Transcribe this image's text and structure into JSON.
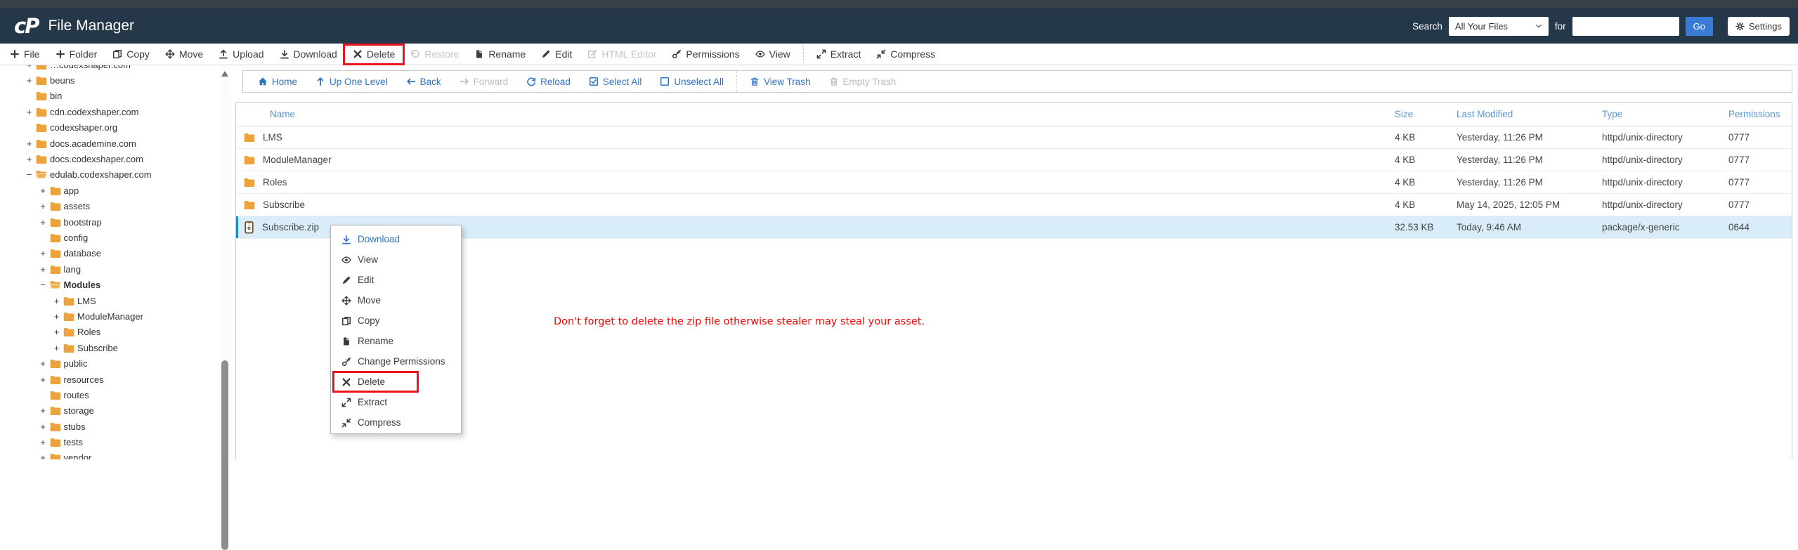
{
  "header": {
    "title": "File Manager",
    "logo_text": "cP",
    "search_label": "Search",
    "search_scope": "All Your Files",
    "for_label": "for",
    "search_value": "",
    "go_label": "Go",
    "settings_label": "Settings"
  },
  "colors": {
    "header_bg": "#25384a",
    "accent_blue": "#2f73c4",
    "go_button_blue": "#3a7cd5",
    "folder_orange": "#eca33c",
    "selected_row_bg": "#d8ecf9",
    "selected_row_edge": "#1f86d2",
    "highlight_red": "#e9141d",
    "annotation_red": "#ff0000"
  },
  "toolbar": {
    "items": [
      {
        "label": "File",
        "icon": "plus"
      },
      {
        "label": "Folder",
        "icon": "plus"
      },
      {
        "label": "Copy",
        "icon": "copy"
      },
      {
        "label": "Move",
        "icon": "move"
      },
      {
        "label": "Upload",
        "icon": "upload"
      },
      {
        "label": "Download",
        "icon": "download"
      },
      {
        "label": "Delete",
        "icon": "x",
        "boxed": true
      },
      {
        "label": "Restore",
        "icon": "restore",
        "disabled": true
      },
      {
        "label": "Rename",
        "icon": "doc"
      },
      {
        "label": "Edit",
        "icon": "pencil"
      },
      {
        "label": "HTML Editor",
        "icon": "code",
        "disabled": true
      },
      {
        "label": "Permissions",
        "icon": "key"
      },
      {
        "label": "View",
        "icon": "eye"
      },
      {
        "divider": true
      },
      {
        "label": "Extract",
        "icon": "extract"
      },
      {
        "label": "Compress",
        "icon": "compress"
      }
    ]
  },
  "pathbar": {
    "items": [
      {
        "label": "Home",
        "icon": "home"
      },
      {
        "label": "Up One Level",
        "icon": "up"
      },
      {
        "label": "Back",
        "icon": "left"
      },
      {
        "label": "Forward",
        "icon": "right",
        "disabled": true
      },
      {
        "label": "Reload",
        "icon": "refresh"
      },
      {
        "label": "Select All",
        "icon": "check-square"
      },
      {
        "label": "Unselect All",
        "icon": "square"
      },
      {
        "divider": true
      },
      {
        "label": "View Trash",
        "icon": "trash"
      },
      {
        "label": "Empty Trash",
        "icon": "trash",
        "disabled": true
      }
    ]
  },
  "sidebar": {
    "items": [
      {
        "label": "…codexshaper.com",
        "level": 0,
        "expander": "+",
        "icon": "folder"
      },
      {
        "label": "beuns",
        "level": 0,
        "expander": "+",
        "icon": "folder"
      },
      {
        "label": "bin",
        "level": 0,
        "expander": "",
        "icon": "folder"
      },
      {
        "label": "cdn.codexshaper.com",
        "level": 0,
        "expander": "+",
        "icon": "folder"
      },
      {
        "label": "codexshaper.org",
        "level": 0,
        "expander": "",
        "icon": "folder"
      },
      {
        "label": "docs.academine.com",
        "level": 0,
        "expander": "+",
        "icon": "folder"
      },
      {
        "label": "docs.codexshaper.com",
        "level": 0,
        "expander": "+",
        "icon": "folder"
      },
      {
        "label": "edulab.codexshaper.com",
        "level": 0,
        "expander": "−",
        "icon": "folder-open"
      },
      {
        "label": "app",
        "level": 1,
        "expander": "+",
        "icon": "folder"
      },
      {
        "label": "assets",
        "level": 1,
        "expander": "+",
        "icon": "folder"
      },
      {
        "label": "bootstrap",
        "level": 1,
        "expander": "+",
        "icon": "folder"
      },
      {
        "label": "config",
        "level": 1,
        "expander": "",
        "icon": "folder"
      },
      {
        "label": "database",
        "level": 1,
        "expander": "+",
        "icon": "folder"
      },
      {
        "label": "lang",
        "level": 1,
        "expander": "+",
        "icon": "folder"
      },
      {
        "label": "Modules",
        "level": 1,
        "expander": "−",
        "icon": "folder-open",
        "bold": true
      },
      {
        "label": "LMS",
        "level": 2,
        "expander": "+",
        "icon": "folder"
      },
      {
        "label": "ModuleManager",
        "level": 2,
        "expander": "+",
        "icon": "folder"
      },
      {
        "label": "Roles",
        "level": 2,
        "expander": "+",
        "icon": "folder"
      },
      {
        "label": "Subscribe",
        "level": 2,
        "expander": "+",
        "icon": "folder"
      },
      {
        "label": "public",
        "level": 1,
        "expander": "+",
        "icon": "folder"
      },
      {
        "label": "resources",
        "level": 1,
        "expander": "+",
        "icon": "folder"
      },
      {
        "label": "routes",
        "level": 1,
        "expander": "",
        "icon": "folder"
      },
      {
        "label": "storage",
        "level": 1,
        "expander": "+",
        "icon": "folder"
      },
      {
        "label": "stubs",
        "level": 1,
        "expander": "+",
        "icon": "folder"
      },
      {
        "label": "tests",
        "level": 1,
        "expander": "+",
        "icon": "folder"
      },
      {
        "label": "vendor",
        "level": 1,
        "expander": "+",
        "icon": "folder"
      }
    ]
  },
  "file_table": {
    "columns": [
      "Name",
      "Size",
      "Last Modified",
      "Type",
      "Permissions"
    ],
    "rows": [
      {
        "name": "LMS",
        "icon": "folder",
        "size": "4 KB",
        "modified": "Yesterday, 11:26 PM",
        "type": "httpd/unix-directory",
        "permissions": "0777"
      },
      {
        "name": "ModuleManager",
        "icon": "folder",
        "size": "4 KB",
        "modified": "Yesterday, 11:26 PM",
        "type": "httpd/unix-directory",
        "permissions": "0777"
      },
      {
        "name": "Roles",
        "icon": "folder",
        "size": "4 KB",
        "modified": "Yesterday, 11:26 PM",
        "type": "httpd/unix-directory",
        "permissions": "0777"
      },
      {
        "name": "Subscribe",
        "icon": "folder",
        "size": "4 KB",
        "modified": "May 14, 2025, 12:05 PM",
        "type": "httpd/unix-directory",
        "permissions": "0777"
      },
      {
        "name": "Subscribe.zip",
        "icon": "zip",
        "size": "32.53 KB",
        "modified": "Today, 9:46 AM",
        "type": "package/x-generic",
        "permissions": "0644",
        "selected": true
      }
    ]
  },
  "context_menu": {
    "items": [
      {
        "label": "Download",
        "icon": "download",
        "accent": true
      },
      {
        "label": "View",
        "icon": "eye"
      },
      {
        "label": "Edit",
        "icon": "pencil"
      },
      {
        "label": "Move",
        "icon": "move"
      },
      {
        "label": "Copy",
        "icon": "copy"
      },
      {
        "label": "Rename",
        "icon": "doc"
      },
      {
        "label": "Change Permissions",
        "icon": "key"
      },
      {
        "label": "Delete",
        "icon": "x",
        "boxed": true
      },
      {
        "label": "Extract",
        "icon": "extract"
      },
      {
        "label": "Compress",
        "icon": "compress"
      }
    ]
  },
  "annotation": {
    "text": "Don't forget to delete the zip file otherwise stealer may steal your asset."
  }
}
